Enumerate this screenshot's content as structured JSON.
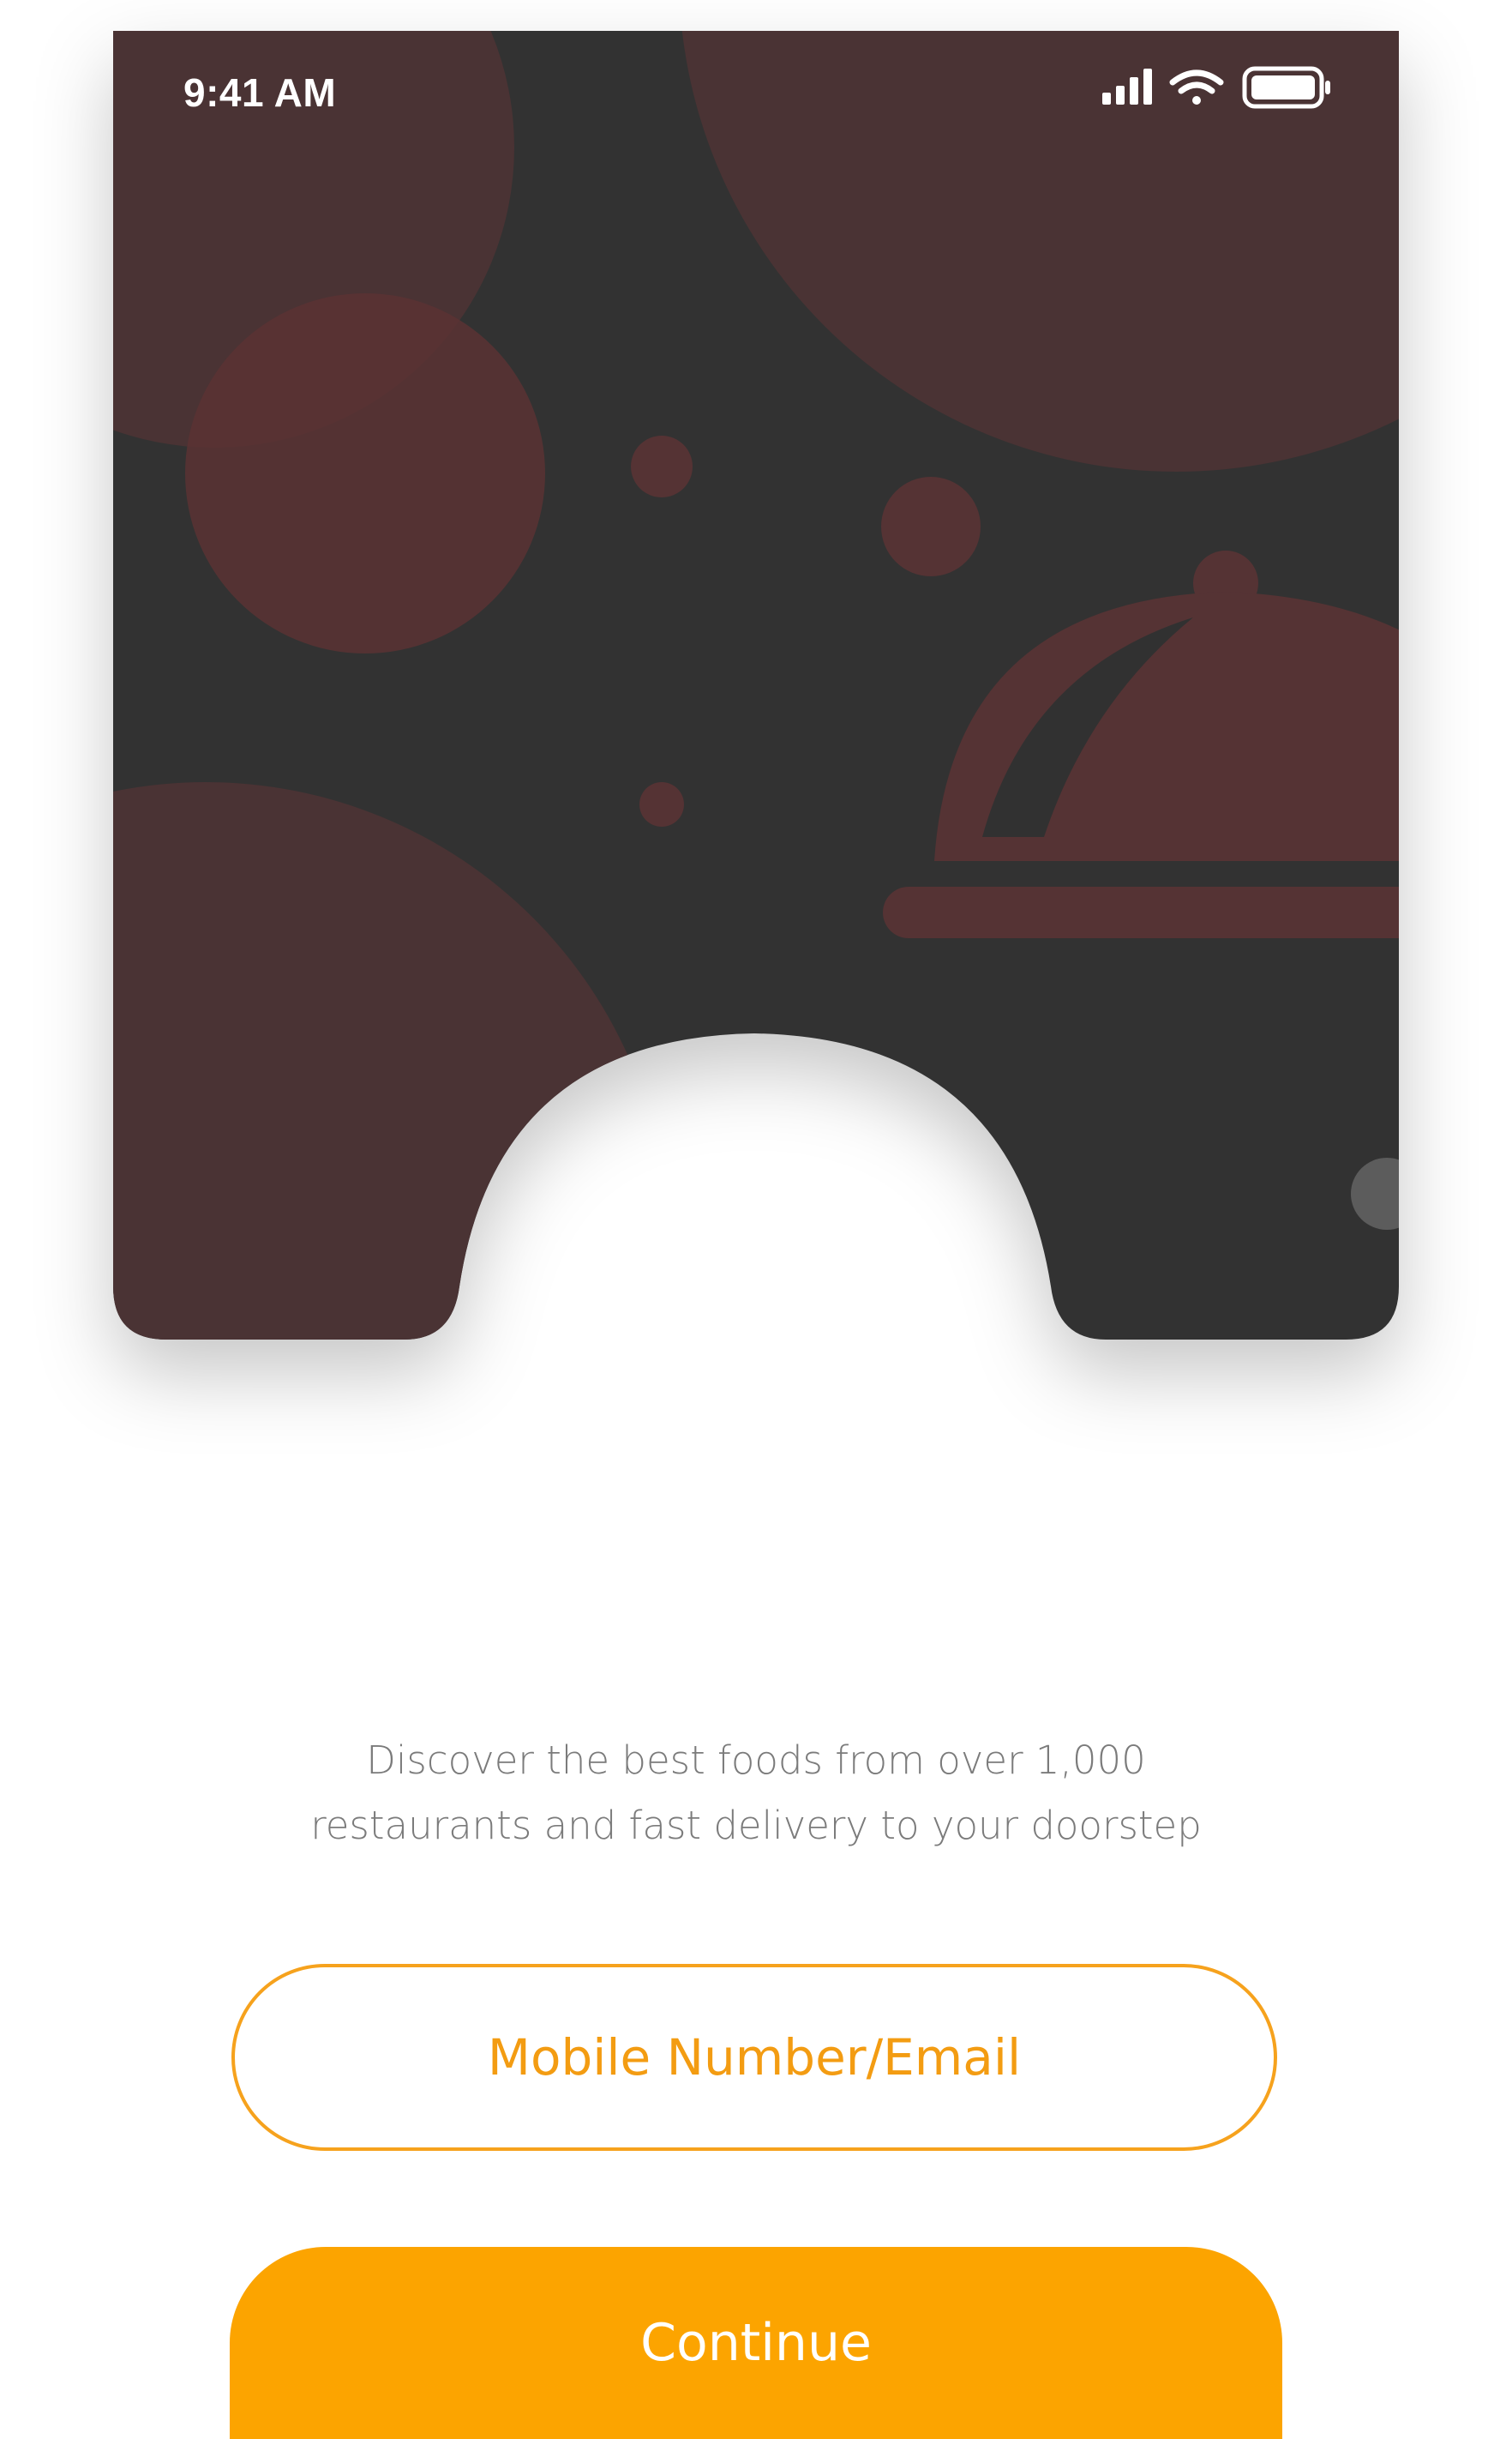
{
  "status_bar": {
    "time": "9:41 AM",
    "icons": [
      "cellular-signal-icon",
      "wifi-icon",
      "battery-icon"
    ]
  },
  "hero": {
    "illustration": "food-cloche-icon",
    "colors": {
      "background": "#313131",
      "circle": "#4a3334",
      "circle_light": "#6b2f32",
      "cloche": "#553334",
      "dot": "#5c5c5c"
    }
  },
  "content": {
    "tagline_line1": "Discover the best foods from over 1,000",
    "tagline_line2": "restaurants and fast delivery to your doorstep"
  },
  "login": {
    "input_placeholder": "Mobile Number/Email",
    "input_value": "",
    "continue_label": "Continue"
  },
  "colors": {
    "accent": "#fca400",
    "accent_text": "#f39c12",
    "text_secondary": "#7b7b7b",
    "background": "#ffffff"
  }
}
